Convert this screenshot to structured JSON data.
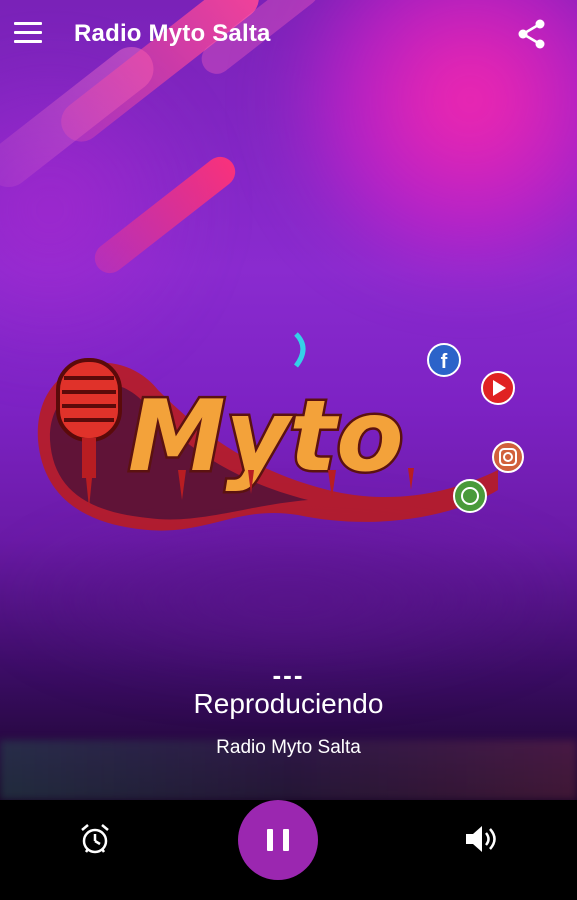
{
  "app": {
    "title": "Radio Myto Salta"
  },
  "logo": {
    "text": "Myto",
    "social_icons": [
      "facebook-icon",
      "youtube-icon",
      "instagram-icon",
      "whatsapp-icon"
    ]
  },
  "now_playing": {
    "separator": "---",
    "status": "Reproduciendo",
    "station": "Radio Myto Salta"
  },
  "controls": {
    "alarm_icon": "alarm-clock-icon",
    "play_state": "playing",
    "volume_icon": "volume-icon"
  },
  "colors": {
    "accent": "#9b27b0",
    "background_top": "#7a22b8",
    "background_bottom": "#000000"
  }
}
